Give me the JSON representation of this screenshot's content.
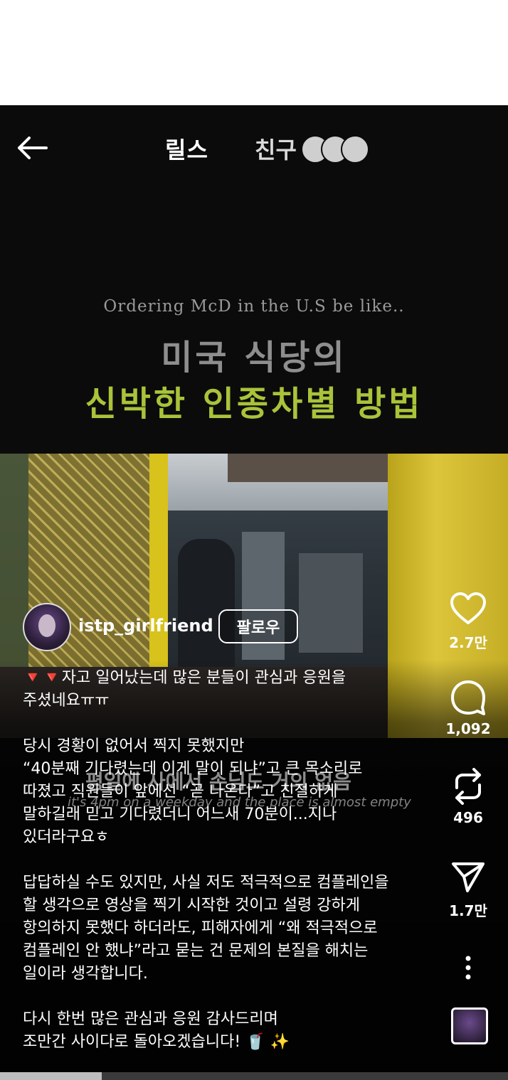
{
  "header": {
    "tab_reels": "릴스",
    "tab_friends": "친구"
  },
  "video": {
    "caption_en": "Ordering McD in the U.S be like..",
    "title_line1": "미국 식당의",
    "title_line2": "신박한 인종차별 방법",
    "subtitle_ko": "평일에 사에서 손님도 거의 없음",
    "subtitle_en": "it's 4pm on a weekday and the place is almost empty"
  },
  "author": {
    "username": "istp_girlfriend",
    "follow_label": "팔로우"
  },
  "description": {
    "lines": [
      "🔻🔻자고 일어났는데 많은 분들이 관심과 응원을",
      "주셨네요ㅠㅠ",
      "",
      "당시 경황이 없어서 찍지 못했지만",
      "“40분째 기다렸는데 이게 말이 되냐”고 큰 목소리로",
      "따졌고 직원들이 앞에선 “곧 나온다”고 친절하게",
      "말하길래 믿고 기다렸더니 어느새 70분이...지나",
      "있더라구요ㅎ",
      "",
      "답답하실 수도 있지만, 사실 저도 적극적으로 컴플레인을",
      "할 생각으로 영상을 찍기 시작한 것이고 설령 강하게",
      "항의하지 못했다 하더라도, 피해자에게 “왜 적극적으로",
      "컴플레인 안 했냐”라고 묻는 건 문제의 본질을 해치는",
      "일이라 생각합니다.",
      "",
      "다시 한번 많은 관심과 응원 감사드리며",
      "조만간 사이다로 돌아오겠습니다! 🥤 ✨"
    ]
  },
  "actions": {
    "likes": "2.7만",
    "comments": "1,092",
    "reposts": "496",
    "shares": "1.7만"
  },
  "progress": 0.2
}
